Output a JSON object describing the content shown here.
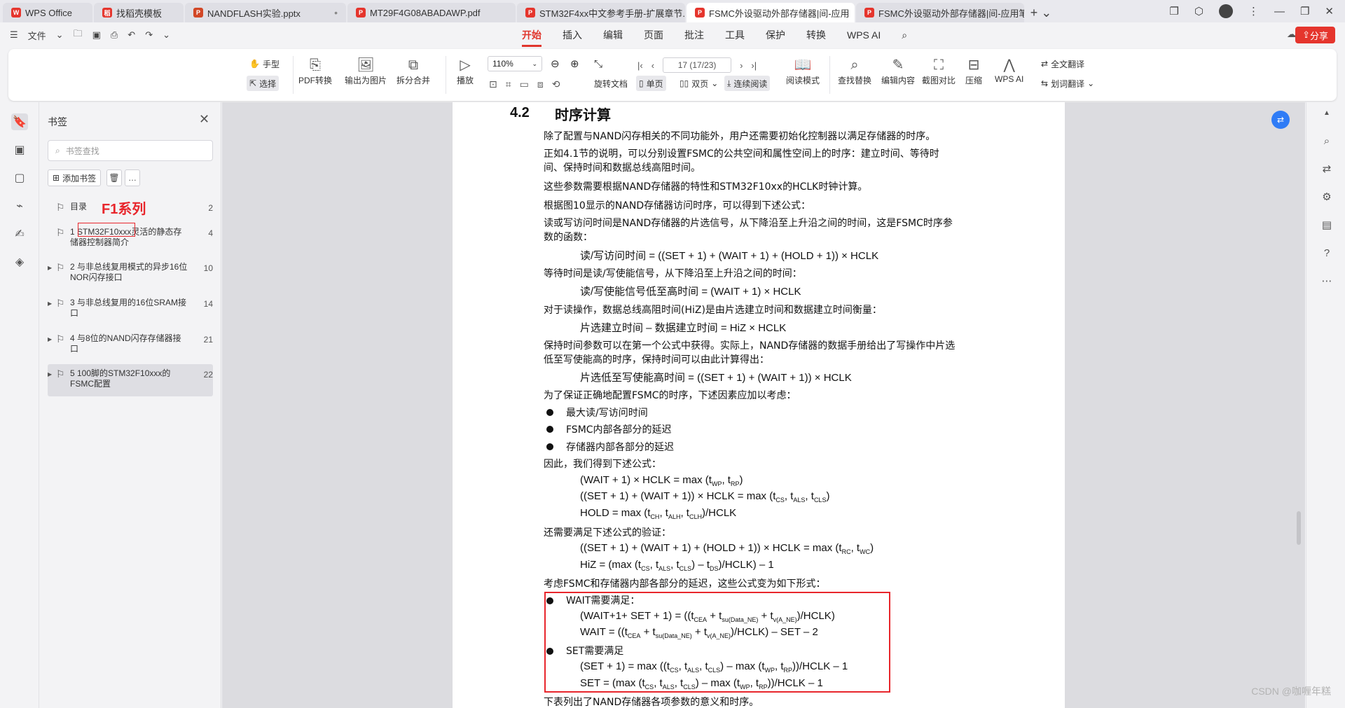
{
  "tabs": [
    {
      "label": "WPS Office",
      "icon": "W",
      "color": "#e5352d"
    },
    {
      "label": "找稻壳模板",
      "icon": "稻",
      "color": "#e5352d"
    },
    {
      "label": "NANDFLASH实验.pptx",
      "icon": "P",
      "color": "#d24726"
    },
    {
      "label": "MT29F4G08ABADAWP.pdf",
      "icon": "P",
      "color": "#e5352d"
    },
    {
      "label": "STM32F4xx中文参考手册-扩展章节.p",
      "icon": "P",
      "color": "#e5352d"
    },
    {
      "label": "FSMC外设驱动外部存储器|间-应用",
      "icon": "P",
      "color": "#e5352d"
    },
    {
      "label": "FSMC外设驱动外部存储器|间-应用笔",
      "icon": "P",
      "color": "#e5352d"
    }
  ],
  "menu": {
    "file": "文件",
    "tabs": [
      "开始",
      "插入",
      "编辑",
      "页面",
      "批注",
      "工具",
      "保护",
      "转换",
      "WPS AI"
    ],
    "share": "分享"
  },
  "toolbar": {
    "hand": "手型",
    "select": "选择",
    "pdf_convert": "PDF转换",
    "export_img": "输出为图片",
    "split_merge": "拆分合并",
    "play": "播放",
    "zoom": "110%",
    "page": "17 (17/23)",
    "rotate": "旋转文档",
    "single": "单页",
    "double": "双页",
    "continuous": "连续阅读",
    "read_mode": "阅读模式",
    "find_replace": "查找替换",
    "edit_content": "编辑内容",
    "screenshot_compare": "截图对比",
    "compress": "压缩",
    "wps_ai": "WPS AI",
    "full_translate": "全文翻译",
    "word_translate": "划词翻译"
  },
  "bookmarks": {
    "title": "书签",
    "search_placeholder": "书签查找",
    "add": "添加书签",
    "note": "F1系列",
    "items": [
      {
        "label": "目录",
        "page": "2",
        "arrow": false
      },
      {
        "label": "1 STM32F10xxx灵活的静态存储器控制器简介",
        "page": "4",
        "arrow": false
      },
      {
        "label": "2 与非总线复用模式的异步16位NOR闪存接口",
        "page": "10",
        "arrow": true
      },
      {
        "label": "3 与非总线复用的16位SRAM接口",
        "page": "14",
        "arrow": true
      },
      {
        "label": "4 与8位的NAND闪存存储器接口",
        "page": "21",
        "arrow": true
      },
      {
        "label": "5 100脚的STM32F10xxx的FSMC配置",
        "page": "22",
        "arrow": true
      }
    ]
  },
  "doc": {
    "sec_num": "4.2",
    "sec_title": "时序计算",
    "l1": "除了配置与NAND闪存相关的不同功能外，用户还需要初始化控制器以满足存储器的时序。",
    "l2a": "正如4.1节的说明，可以分别设置FSMC的公共空间和属性空间上的时序：建立时间、等待时",
    "l2b": "间、保持时间和数据总线高阻时间。",
    "l3": "这些参数需要根据NAND存储器的特性和STM32F10xx的HCLK时钟计算。",
    "l4": "根据图10显示的NAND存储器访问时序，可以得到下述公式：",
    "l5a": "读或写访问时间是NAND存储器的片选信号，从下降沿至上升沿之间的时间，这是FSMC时序参",
    "l5b": "数的函数：",
    "f1": "读/写访问时间 = ((SET + 1) + (WAIT + 1) + (HOLD + 1)) × HCLK",
    "l6": "等待时间是读/写使能信号，从下降沿至上升沿之间的时间：",
    "f2": "读/写使能信号低至高时间 = (WAIT + 1) × HCLK",
    "l7": "对于读操作，数据总线高阻时间(HiZ)是由片选建立时间和数据建立时间衡量：",
    "f3": "片选建立时间 – 数据建立时间 = HiZ × HCLK",
    "l8a": "保持时间参数可以在第一个公式中获得。实际上，NAND存储器的数据手册给出了写操作中片选",
    "l8b": "低至写使能高的时序，保持时间可以由此计算得出：",
    "f4": "片选低至写使能高时间 = ((SET + 1) + (WAIT + 1)) × HCLK",
    "l9": "为了保证正确地配置FSMC的时序，下述因素应加以考虑：",
    "b1": "最大读/写访问时间",
    "b2": "FSMC内部各部分的延迟",
    "b3": "存储器内部各部分的延迟",
    "l10": "因此，我们得到下述公式：",
    "e1": "(WAIT + 1) × HCLK = max (t<sub>WP</sub>, t<sub>RP</sub>)",
    "e2": "((SET + 1) + (WAIT + 1)) × HCLK = max (t<sub>CS</sub>, t<sub>ALS</sub>, t<sub>CLS</sub>)",
    "e3": "HOLD = max (t<sub>CH</sub>, t<sub>ALH</sub>, t<sub>CLH</sub>)/HCLK",
    "l11": "还需要满足下述公式的验证：",
    "e4": "((SET + 1) + (WAIT + 1) + (HOLD + 1)) × HCLK = max (t<sub>RC</sub>, t<sub>WC</sub>)",
    "e5": "HiZ = (max (t<sub>CS</sub>, t<sub>ALS</sub>, t<sub>CLS</sub>) – t<sub>DS</sub>)/HCLK) – 1",
    "l12": "考虑FSMC和存储器内部各部分的延迟，这些公式变为如下形式：",
    "w_title": "WAIT需要满足：",
    "w1": "(WAIT+1+ SET + 1) = ((t<sub>CEA</sub> + t<sub>su(Data_NE)</sub> + t<sub>v(A_NE)</sub>)/HCLK)",
    "w2": "WAIT = ((t<sub>CEA</sub> + t<sub>su(Data_NE)</sub> + t<sub>v(A_NE)</sub>)/HCLK) – SET – 2",
    "s_title": "SET需要满足",
    "s1": "(SET + 1) = max ((t<sub>CS</sub>, t<sub>ALS</sub>, t<sub>CLS</sub>) – max (t<sub>WP</sub>, t<sub>RP</sub>))/HCLK – 1",
    "s2": "SET = (max (t<sub>CS</sub>, t<sub>ALS</sub>, t<sub>CLS</sub>) – max (t<sub>WP</sub>, t<sub>RP</sub>))/HCLK – 1",
    "l13": "下表列出了NAND存储器各项参数的意义和时序。"
  },
  "watermark": "CSDN @咖喱年糕"
}
